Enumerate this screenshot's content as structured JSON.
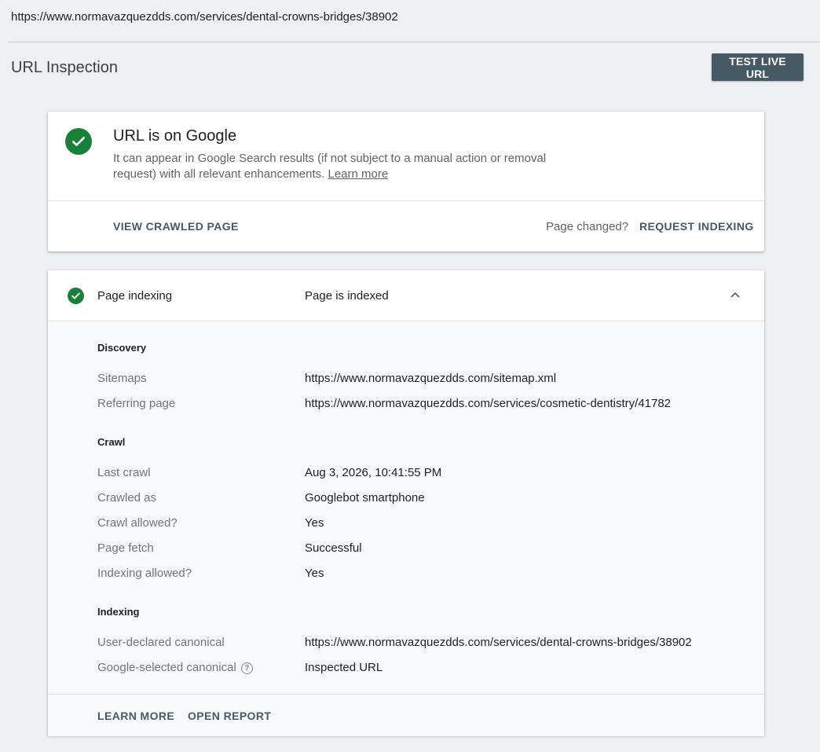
{
  "url_bar": {
    "url": "https://www.normavazquezdds.com/services/dental-crowns-bridges/38902"
  },
  "header": {
    "title": "URL Inspection",
    "test_live_label": "TEST LIVE URL"
  },
  "status_card": {
    "heading": "URL is on Google",
    "description": "It can appear in Google Search results (if not subject to a manual action or removal request) with all relevant enhancements.",
    "learn_more_link": "Learn more",
    "view_crawled_label": "VIEW CRAWLED PAGE",
    "page_changed_text": "Page changed?",
    "request_indexing_label": "REQUEST INDEXING",
    "status_color": "#188038",
    "icon": "check-circle-icon"
  },
  "indexing_card": {
    "label": "Page indexing",
    "value": "Page is indexed",
    "icon": "check-circle-icon",
    "expand_icon": "chevron-up-icon",
    "sections": {
      "discovery": {
        "title": "Discovery",
        "sitemaps_label": "Sitemaps",
        "sitemaps_value": "https://www.normavazquezdds.com/sitemap.xml",
        "referring_label": "Referring page",
        "referring_value": "https://www.normavazquezdds.com/services/cosmetic-dentistry/41782"
      },
      "crawl": {
        "title": "Crawl",
        "last_crawl_label": "Last crawl",
        "last_crawl_value": "Aug 3, 2026, 10:41:55 PM",
        "crawled_as_label": "Crawled as",
        "crawled_as_value": "Googlebot smartphone",
        "crawl_allowed_label": "Crawl allowed?",
        "crawl_allowed_value": "Yes",
        "page_fetch_label": "Page fetch",
        "page_fetch_value": "Successful",
        "indexing_allowed_label": "Indexing allowed?",
        "indexing_allowed_value": "Yes"
      },
      "indexing": {
        "title": "Indexing",
        "user_canonical_label": "User-declared canonical",
        "user_canonical_value": "https://www.normavazquezdds.com/services/dental-crowns-bridges/38902",
        "google_canonical_label": "Google-selected canonical",
        "google_canonical_value": "Inspected URL",
        "help_icon": "help-circle-icon"
      }
    },
    "learn_more_label": "LEARN MORE",
    "open_report_label": "OPEN REPORT"
  },
  "colors": {
    "background": "#eef0f3",
    "button": "#455a64",
    "success": "#188038"
  }
}
